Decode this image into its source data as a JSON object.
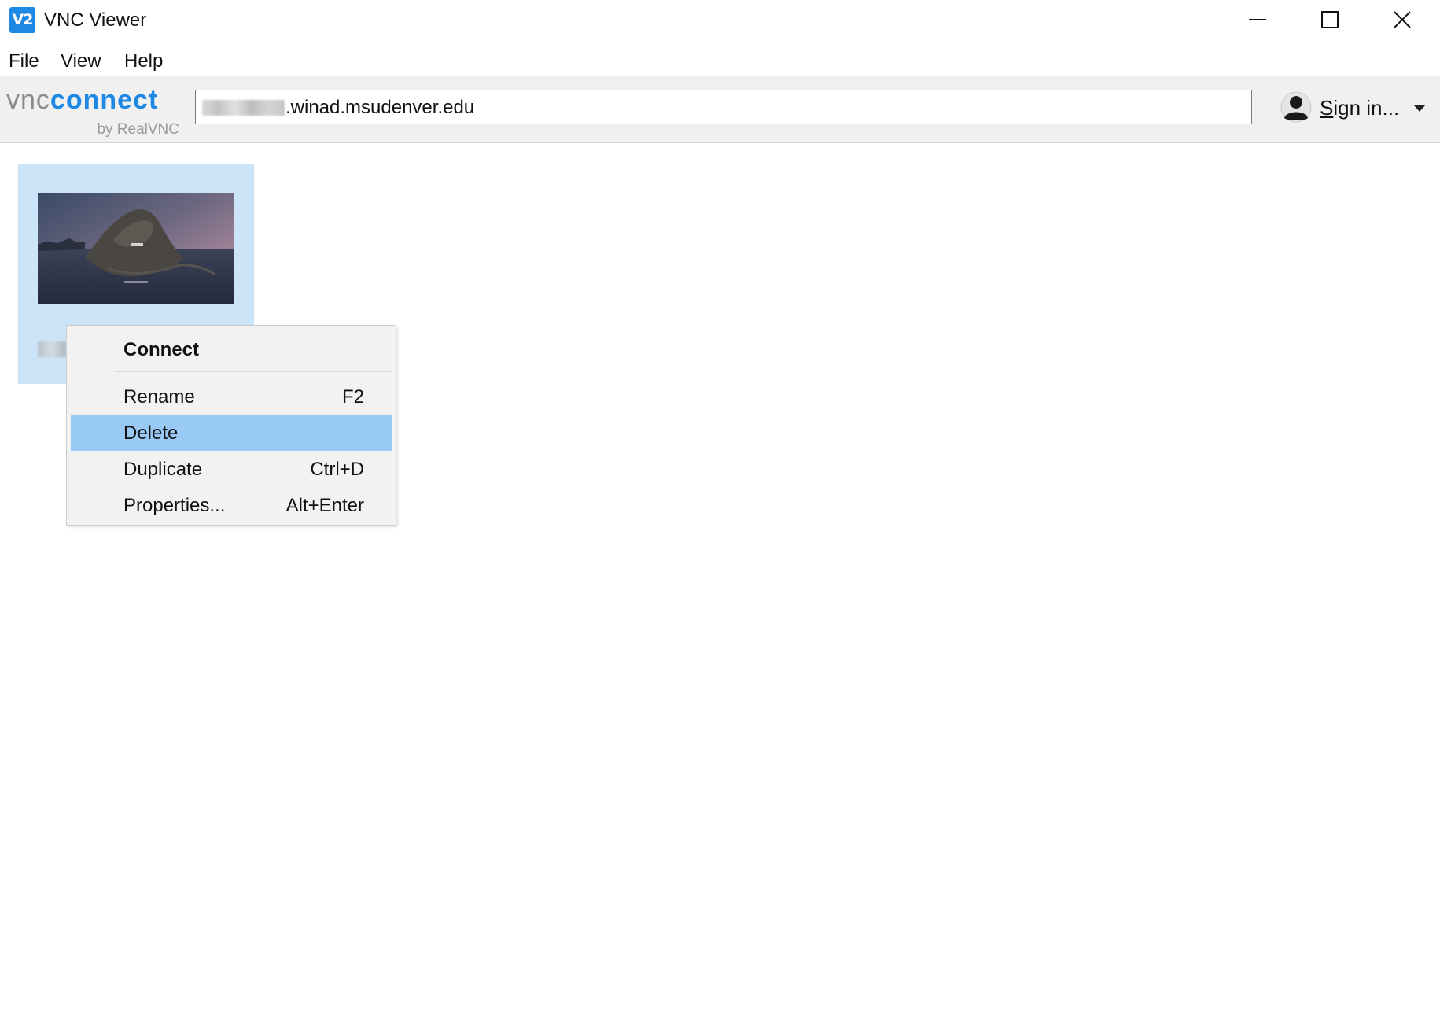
{
  "window": {
    "title": "VNC Viewer",
    "app_icon_text": "V2",
    "controls": {
      "minimize_icon": "minimize-icon",
      "maximize_icon": "maximize-icon",
      "close_icon": "close-icon"
    }
  },
  "menubar": {
    "items": [
      {
        "label": "File"
      },
      {
        "label": "View"
      },
      {
        "label": "Help"
      }
    ]
  },
  "toolbar": {
    "logo": {
      "vnc": "vnc",
      "connect": "connect",
      "byline": "by RealVNC"
    },
    "address": {
      "value": ".winad.msudenver.edu"
    },
    "signin": {
      "label_first": "S",
      "label_rest": "ign in...",
      "avatar_icon": "user-avatar-icon",
      "dropdown_icon": "chevron-down-icon"
    }
  },
  "connection_tile": {
    "selected": true,
    "thumbnail": "desktop-preview-image"
  },
  "context_menu": {
    "items": [
      {
        "label": "Connect",
        "shortcut": "",
        "bold": true,
        "highlighted": false
      },
      {
        "label": "Rename",
        "shortcut": "F2",
        "bold": false,
        "highlighted": false
      },
      {
        "label": "Delete",
        "shortcut": "",
        "bold": false,
        "highlighted": true
      },
      {
        "label": "Duplicate",
        "shortcut": "Ctrl+D",
        "bold": false,
        "highlighted": false
      },
      {
        "label": "Properties...",
        "shortcut": "Alt+Enter",
        "bold": false,
        "highlighted": false
      }
    ]
  },
  "colors": {
    "accent": "#1e88e5",
    "tile_selected": "#cce4f7",
    "menu_highlight": "#99c9f5",
    "toolbar_bg": "#f0f0f0",
    "menu_bg": "#f2f2f2"
  }
}
